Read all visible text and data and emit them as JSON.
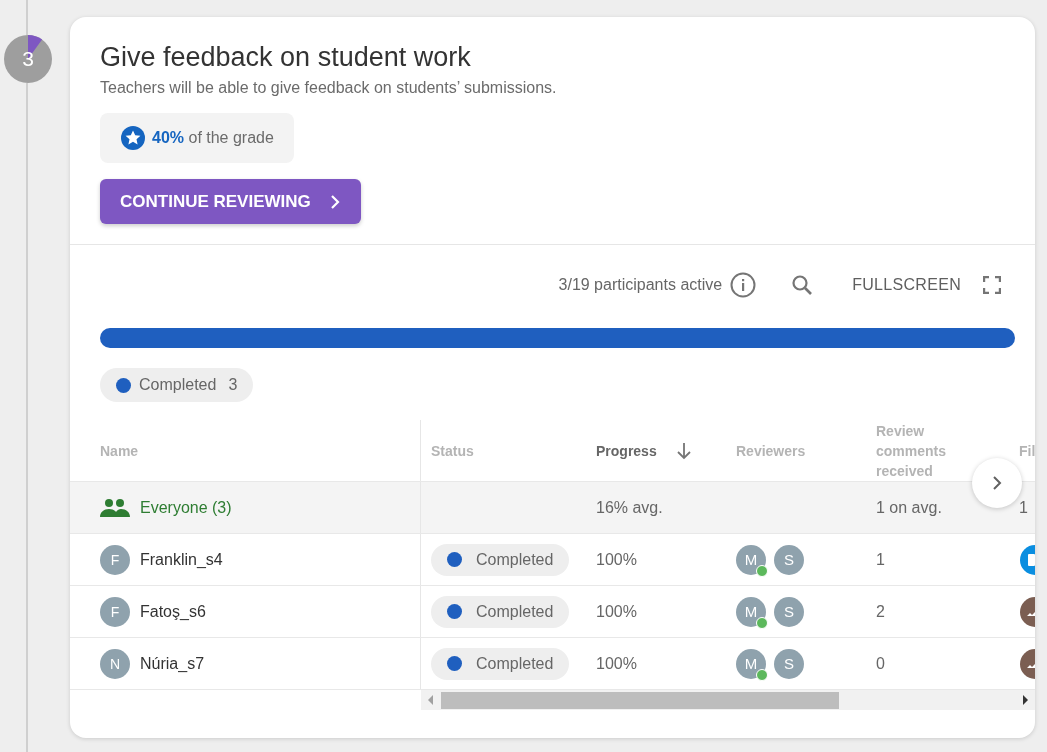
{
  "step": {
    "number": "3",
    "level": 0.1
  },
  "task": {
    "title": "Give feedback on student work",
    "description": "Teachers will be able to give feedback on students’ submissions.",
    "grade": "**40%** of the grade",
    "button": "CONTINUE REVIEWING"
  },
  "toolbar": {
    "participants": "3/19 participants active",
    "fullscreen": "FULLSCREEN"
  },
  "progress_bar": {
    "level": 1.0,
    "color": "#1f5fbf"
  },
  "legend": [
    {
      "label": "Completed",
      "count": "3",
      "color": "#1f5fbf"
    }
  ],
  "table": {
    "columns": [
      {
        "label": "Name",
        "sorted": false
      },
      {
        "label": "Status",
        "sorted": false
      },
      {
        "label": "Progress",
        "sorted": true
      },
      {
        "label": "Reviewers",
        "sorted": false
      },
      {
        "label": "Review comments received",
        "sorted": false
      },
      {
        "label": "Fil",
        "sorted": false
      }
    ],
    "summary": {
      "name": "Everyone (3)",
      "progress": "16% avg.",
      "comments": "1 on avg.",
      "files": "1"
    },
    "rows": [
      {
        "initial": "F",
        "name": "Franklin_s4",
        "status": {
          "label": "Completed",
          "color": "#1f5fbf"
        },
        "progress": "100%",
        "reviewers": [
          {
            "initial": "M",
            "online": true
          },
          {
            "initial": "S",
            "online": false
          }
        ],
        "comments": "1",
        "file": {
          "kind": "app"
        }
      },
      {
        "initial": "F",
        "name": "Fatoş_s6",
        "status": {
          "label": "Completed",
          "color": "#1f5fbf"
        },
        "progress": "100%",
        "reviewers": [
          {
            "initial": "M",
            "online": true
          },
          {
            "initial": "S",
            "online": false
          }
        ],
        "comments": "2",
        "file": {
          "kind": "image"
        }
      },
      {
        "initial": "N",
        "name": "Núria_s7",
        "status": {
          "label": "Completed",
          "color": "#1f5fbf"
        },
        "progress": "100%",
        "reviewers": [
          {
            "initial": "M",
            "online": true
          },
          {
            "initial": "S",
            "online": false
          }
        ],
        "comments": "0",
        "file": {
          "kind": "image"
        }
      }
    ]
  }
}
